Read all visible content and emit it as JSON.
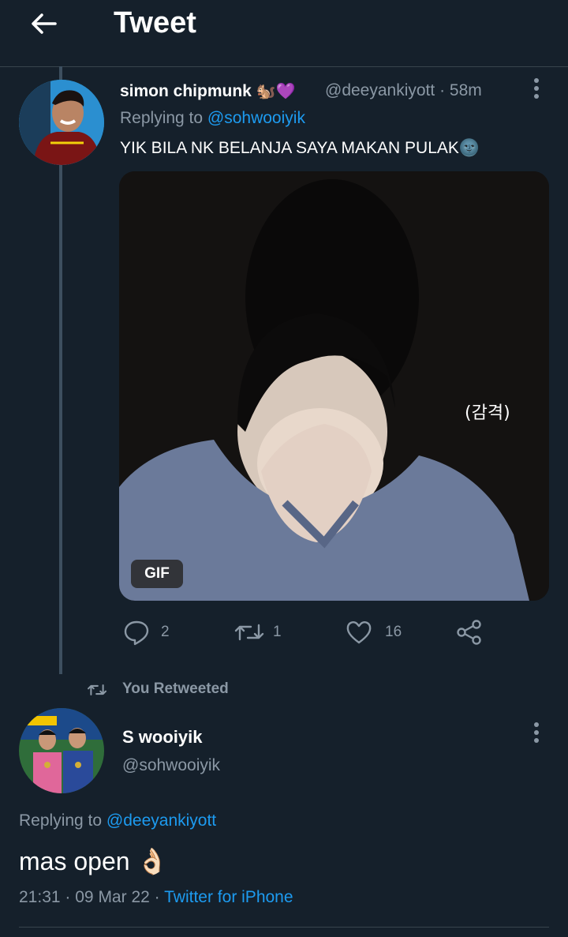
{
  "header": {
    "title": "Tweet",
    "back_icon": "arrow-left-icon"
  },
  "reply_tweet": {
    "author_name": "simon chipmunk",
    "author_emojis": "🐿️💜",
    "handle": "@deeyankiyott",
    "separator": "·",
    "time_ago": "58m",
    "replying_prefix": "Replying to",
    "replying_to": "@sohwooiyik",
    "text": "YIK BILA NK BELANJA SAYA MAKAN PULAK🌚",
    "media": {
      "badge": "GIF",
      "caption": "(감격)"
    },
    "actions": {
      "reply_count": "2",
      "retweet_count": "1",
      "like_count": "16"
    }
  },
  "retweet_context": {
    "label": "You Retweeted"
  },
  "main_tweet": {
    "author_name": "S wooiyik",
    "handle": "@sohwooiyik",
    "replying_prefix": "Replying to",
    "replying_to": "@deeyankiyott",
    "text": "mas open 👌🏻",
    "time": "21:31",
    "sep1": "·",
    "date": "09 Mar 22",
    "sep2": "·",
    "source": "Twitter for iPhone"
  },
  "colors": {
    "background": "#15202b",
    "accent": "#1d9bf0",
    "muted": "#8b98a5",
    "divider": "#38444d"
  }
}
